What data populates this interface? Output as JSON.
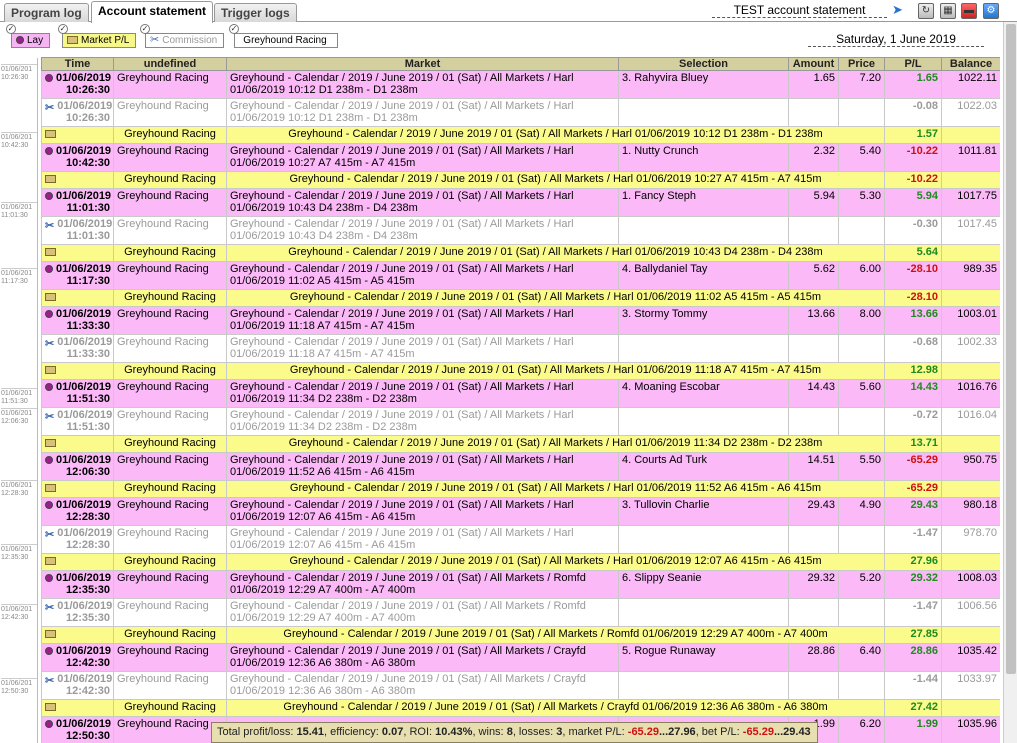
{
  "tabs": [
    {
      "label": "Program log",
      "active": false
    },
    {
      "label": "Account statement",
      "active": true
    },
    {
      "label": "Trigger logs",
      "active": false
    }
  ],
  "header": {
    "title": "TEST account statement"
  },
  "filters": {
    "lay": "Lay",
    "market_pl": "Market P/L",
    "commission": "Commission",
    "sport": "Greyhound Racing"
  },
  "date_label": "Saturday, 1 June 2019",
  "columns": [
    "Time",
    "undefined",
    "Market",
    "Selection",
    "Amount",
    "Price",
    "P/L",
    "Balance"
  ],
  "gutter_times": [
    "01/06/201 10:26:30",
    "01/06/201 10:42:30",
    "01/06/201 11:01:30",
    "01/06/201 11:17:30",
    "01/06/201 11:51:30",
    "01/06/201 12:06:30",
    "01/06/201 12:28:30",
    "01/06/201 12:35:30",
    "01/06/201 12:42:30",
    "01/06/201 12:50:30"
  ],
  "rows": [
    {
      "type": "bet",
      "date": "01/06/2019",
      "time": "10:26:30",
      "sport": "Greyhound Racing",
      "market1": "Greyhound - Calendar / 2019 / June 2019 / 01 (Sat) / All Markets / Harl",
      "market2": "01/06/2019 10:12 D1 238m - D1 238m",
      "selection": "3. Rahyvira Bluey",
      "amount": "1.65",
      "price": "7.20",
      "pl": "1.65",
      "balance": "1022.11"
    },
    {
      "type": "comm",
      "date": "01/06/2019",
      "time": "10:26:30",
      "sport": "Greyhound Racing",
      "market1": "Greyhound - Calendar / 2019 / June 2019 / 01 (Sat) / All Markets / Harl",
      "market2": "01/06/2019 10:12 D1 238m - D1 238m",
      "pl": "-0.08",
      "balance": "1022.03"
    },
    {
      "type": "mkt",
      "sport": "Greyhound Racing",
      "market": "Greyhound - Calendar / 2019 / June 2019 / 01 (Sat) / All Markets / Harl 01/06/2019 10:12 D1 238m - D1 238m",
      "pl": "1.57"
    },
    {
      "type": "bet",
      "date": "01/06/2019",
      "time": "10:42:30",
      "sport": "Greyhound Racing",
      "market1": "Greyhound - Calendar / 2019 / June 2019 / 01 (Sat) / All Markets / Harl",
      "market2": "01/06/2019 10:27 A7 415m - A7 415m",
      "selection": "1. Nutty Crunch",
      "amount": "2.32",
      "price": "5.40",
      "pl": "-10.22",
      "balance": "1011.81"
    },
    {
      "type": "mkt",
      "sport": "Greyhound Racing",
      "market": "Greyhound - Calendar / 2019 / June 2019 / 01 (Sat) / All Markets / Harl 01/06/2019 10:27 A7 415m - A7 415m",
      "pl": "-10.22"
    },
    {
      "type": "bet",
      "date": "01/06/2019",
      "time": "11:01:30",
      "sport": "Greyhound Racing",
      "market1": "Greyhound - Calendar / 2019 / June 2019 / 01 (Sat) / All Markets / Harl",
      "market2": "01/06/2019 10:43 D4 238m - D4 238m",
      "selection": "1. Fancy Steph",
      "amount": "5.94",
      "price": "5.30",
      "pl": "5.94",
      "balance": "1017.75"
    },
    {
      "type": "comm",
      "date": "01/06/2019",
      "time": "11:01:30",
      "sport": "Greyhound Racing",
      "market1": "Greyhound - Calendar / 2019 / June 2019 / 01 (Sat) / All Markets / Harl",
      "market2": "01/06/2019 10:43 D4 238m - D4 238m",
      "pl": "-0.30",
      "balance": "1017.45"
    },
    {
      "type": "mkt",
      "sport": "Greyhound Racing",
      "market": "Greyhound - Calendar / 2019 / June 2019 / 01 (Sat) / All Markets / Harl 01/06/2019 10:43 D4 238m - D4 238m",
      "pl": "5.64"
    },
    {
      "type": "bet",
      "date": "01/06/2019",
      "time": "11:17:30",
      "sport": "Greyhound Racing",
      "market1": "Greyhound - Calendar / 2019 / June 2019 / 01 (Sat) / All Markets / Harl",
      "market2": "01/06/2019 11:02 A5 415m - A5 415m",
      "selection": "4. Ballydaniel Tay",
      "amount": "5.62",
      "price": "6.00",
      "pl": "-28.10",
      "balance": "989.35"
    },
    {
      "type": "mkt",
      "sport": "Greyhound Racing",
      "market": "Greyhound - Calendar / 2019 / June 2019 / 01 (Sat) / All Markets / Harl 01/06/2019 11:02 A5 415m - A5 415m",
      "pl": "-28.10"
    },
    {
      "type": "bet",
      "date": "01/06/2019",
      "time": "11:33:30",
      "sport": "Greyhound Racing",
      "market1": "Greyhound - Calendar / 2019 / June 2019 / 01 (Sat) / All Markets / Harl",
      "market2": "01/06/2019 11:18 A7 415m - A7 415m",
      "selection": "3. Stormy Tommy",
      "amount": "13.66",
      "price": "8.00",
      "pl": "13.66",
      "balance": "1003.01"
    },
    {
      "type": "comm",
      "date": "01/06/2019",
      "time": "11:33:30",
      "sport": "Greyhound Racing",
      "market1": "Greyhound - Calendar / 2019 / June 2019 / 01 (Sat) / All Markets / Harl",
      "market2": "01/06/2019 11:18 A7 415m - A7 415m",
      "pl": "-0.68",
      "balance": "1002.33"
    },
    {
      "type": "mkt",
      "sport": "Greyhound Racing",
      "market": "Greyhound - Calendar / 2019 / June 2019 / 01 (Sat) / All Markets / Harl 01/06/2019 11:18 A7 415m - A7 415m",
      "pl": "12.98"
    },
    {
      "type": "bet",
      "date": "01/06/2019",
      "time": "11:51:30",
      "sport": "Greyhound Racing",
      "market1": "Greyhound - Calendar / 2019 / June 2019 / 01 (Sat) / All Markets / Harl",
      "market2": "01/06/2019 11:34 D2 238m - D2 238m",
      "selection": "4. Moaning Escobar",
      "amount": "14.43",
      "price": "5.60",
      "pl": "14.43",
      "balance": "1016.76"
    },
    {
      "type": "comm",
      "date": "01/06/2019",
      "time": "11:51:30",
      "sport": "Greyhound Racing",
      "market1": "Greyhound - Calendar / 2019 / June 2019 / 01 (Sat) / All Markets / Harl",
      "market2": "01/06/2019 11:34 D2 238m - D2 238m",
      "pl": "-0.72",
      "balance": "1016.04"
    },
    {
      "type": "mkt",
      "sport": "Greyhound Racing",
      "market": "Greyhound - Calendar / 2019 / June 2019 / 01 (Sat) / All Markets / Harl 01/06/2019 11:34 D2 238m - D2 238m",
      "pl": "13.71"
    },
    {
      "type": "bet",
      "date": "01/06/2019",
      "time": "12:06:30",
      "sport": "Greyhound Racing",
      "market1": "Greyhound - Calendar / 2019 / June 2019 / 01 (Sat) / All Markets / Harl",
      "market2": "01/06/2019 11:52 A6 415m - A6 415m",
      "selection": "4. Courts Ad Turk",
      "amount": "14.51",
      "price": "5.50",
      "pl": "-65.29",
      "balance": "950.75"
    },
    {
      "type": "mkt",
      "sport": "Greyhound Racing",
      "market": "Greyhound - Calendar / 2019 / June 2019 / 01 (Sat) / All Markets / Harl 01/06/2019 11:52 A6 415m - A6 415m",
      "pl": "-65.29"
    },
    {
      "type": "bet",
      "date": "01/06/2019",
      "time": "12:28:30",
      "sport": "Greyhound Racing",
      "market1": "Greyhound - Calendar / 2019 / June 2019 / 01 (Sat) / All Markets / Harl",
      "market2": "01/06/2019 12:07 A6 415m - A6 415m",
      "selection": "3. Tullovin Charlie",
      "amount": "29.43",
      "price": "4.90",
      "pl": "29.43",
      "balance": "980.18"
    },
    {
      "type": "comm",
      "date": "01/06/2019",
      "time": "12:28:30",
      "sport": "Greyhound Racing",
      "market1": "Greyhound - Calendar / 2019 / June 2019 / 01 (Sat) / All Markets / Harl",
      "market2": "01/06/2019 12:07 A6 415m - A6 415m",
      "pl": "-1.47",
      "balance": "978.70"
    },
    {
      "type": "mkt",
      "sport": "Greyhound Racing",
      "market": "Greyhound - Calendar / 2019 / June 2019 / 01 (Sat) / All Markets / Harl 01/06/2019 12:07 A6 415m - A6 415m",
      "pl": "27.96"
    },
    {
      "type": "bet",
      "date": "01/06/2019",
      "time": "12:35:30",
      "sport": "Greyhound Racing",
      "market1": "Greyhound - Calendar / 2019 / June 2019 / 01 (Sat) / All Markets / Romfd",
      "market2": "01/06/2019 12:29 A7 400m - A7 400m",
      "selection": "6. Slippy Seanie",
      "amount": "29.32",
      "price": "5.20",
      "pl": "29.32",
      "balance": "1008.03"
    },
    {
      "type": "comm",
      "date": "01/06/2019",
      "time": "12:35:30",
      "sport": "Greyhound Racing",
      "market1": "Greyhound - Calendar / 2019 / June 2019 / 01 (Sat) / All Markets / Romfd",
      "market2": "01/06/2019 12:29 A7 400m - A7 400m",
      "pl": "-1.47",
      "balance": "1006.56"
    },
    {
      "type": "mkt",
      "sport": "Greyhound Racing",
      "market": "Greyhound - Calendar / 2019 / June 2019 / 01 (Sat) / All Markets / Romfd 01/06/2019 12:29 A7 400m - A7 400m",
      "pl": "27.85"
    },
    {
      "type": "bet",
      "date": "01/06/2019",
      "time": "12:42:30",
      "sport": "Greyhound Racing",
      "market1": "Greyhound - Calendar / 2019 / June 2019 / 01 (Sat) / All Markets / Crayfd",
      "market2": "01/06/2019 12:36 A6 380m - A6 380m",
      "selection": "5. Rogue Runaway",
      "amount": "28.86",
      "price": "6.40",
      "pl": "28.86",
      "balance": "1035.42"
    },
    {
      "type": "comm",
      "date": "01/06/2019",
      "time": "12:42:30",
      "sport": "Greyhound Racing",
      "market1": "Greyhound - Calendar / 2019 / June 2019 / 01 (Sat) / All Markets / Crayfd",
      "market2": "01/06/2019 12:36 A6 380m - A6 380m",
      "pl": "-1.44",
      "balance": "1033.97"
    },
    {
      "type": "mkt",
      "sport": "Greyhound Racing",
      "market": "Greyhound - Calendar / 2019 / June 2019 / 01 (Sat) / All Markets / Crayfd 01/06/2019 12:36 A6 380m - A6 380m",
      "pl": "27.42"
    },
    {
      "type": "bet",
      "date": "01/06/2019",
      "time": "12:50:30",
      "sport": "Greyhound Racing",
      "market1": "",
      "market2": "",
      "selection": "",
      "amount": "1.99",
      "price": "6.20",
      "pl": "1.99",
      "balance": "1035.96"
    }
  ],
  "status": {
    "total_label": "Total profit/loss:",
    "total": "15.41",
    "eff_label": ", efficiency:",
    "efficiency": "0.07",
    "roi_label": ", ROI:",
    "roi": "10.43%",
    "wins_label": ", wins:",
    "wins": "8",
    "losses_label": ", losses:",
    "losses": "3",
    "mpl_label": ", market P/L:",
    "mpl_min": "-65.29",
    "mpl_max": "...27.96",
    "bpl_label": ", bet P/L:",
    "bpl_min": "-65.29",
    "bpl_max": "...29.43"
  },
  "colors": {
    "bet_row": "#fbb9f7",
    "market_row": "#fbfb8c",
    "header": "#d4cf9f",
    "profit": "#1f8a1f",
    "loss": "#d01010"
  }
}
